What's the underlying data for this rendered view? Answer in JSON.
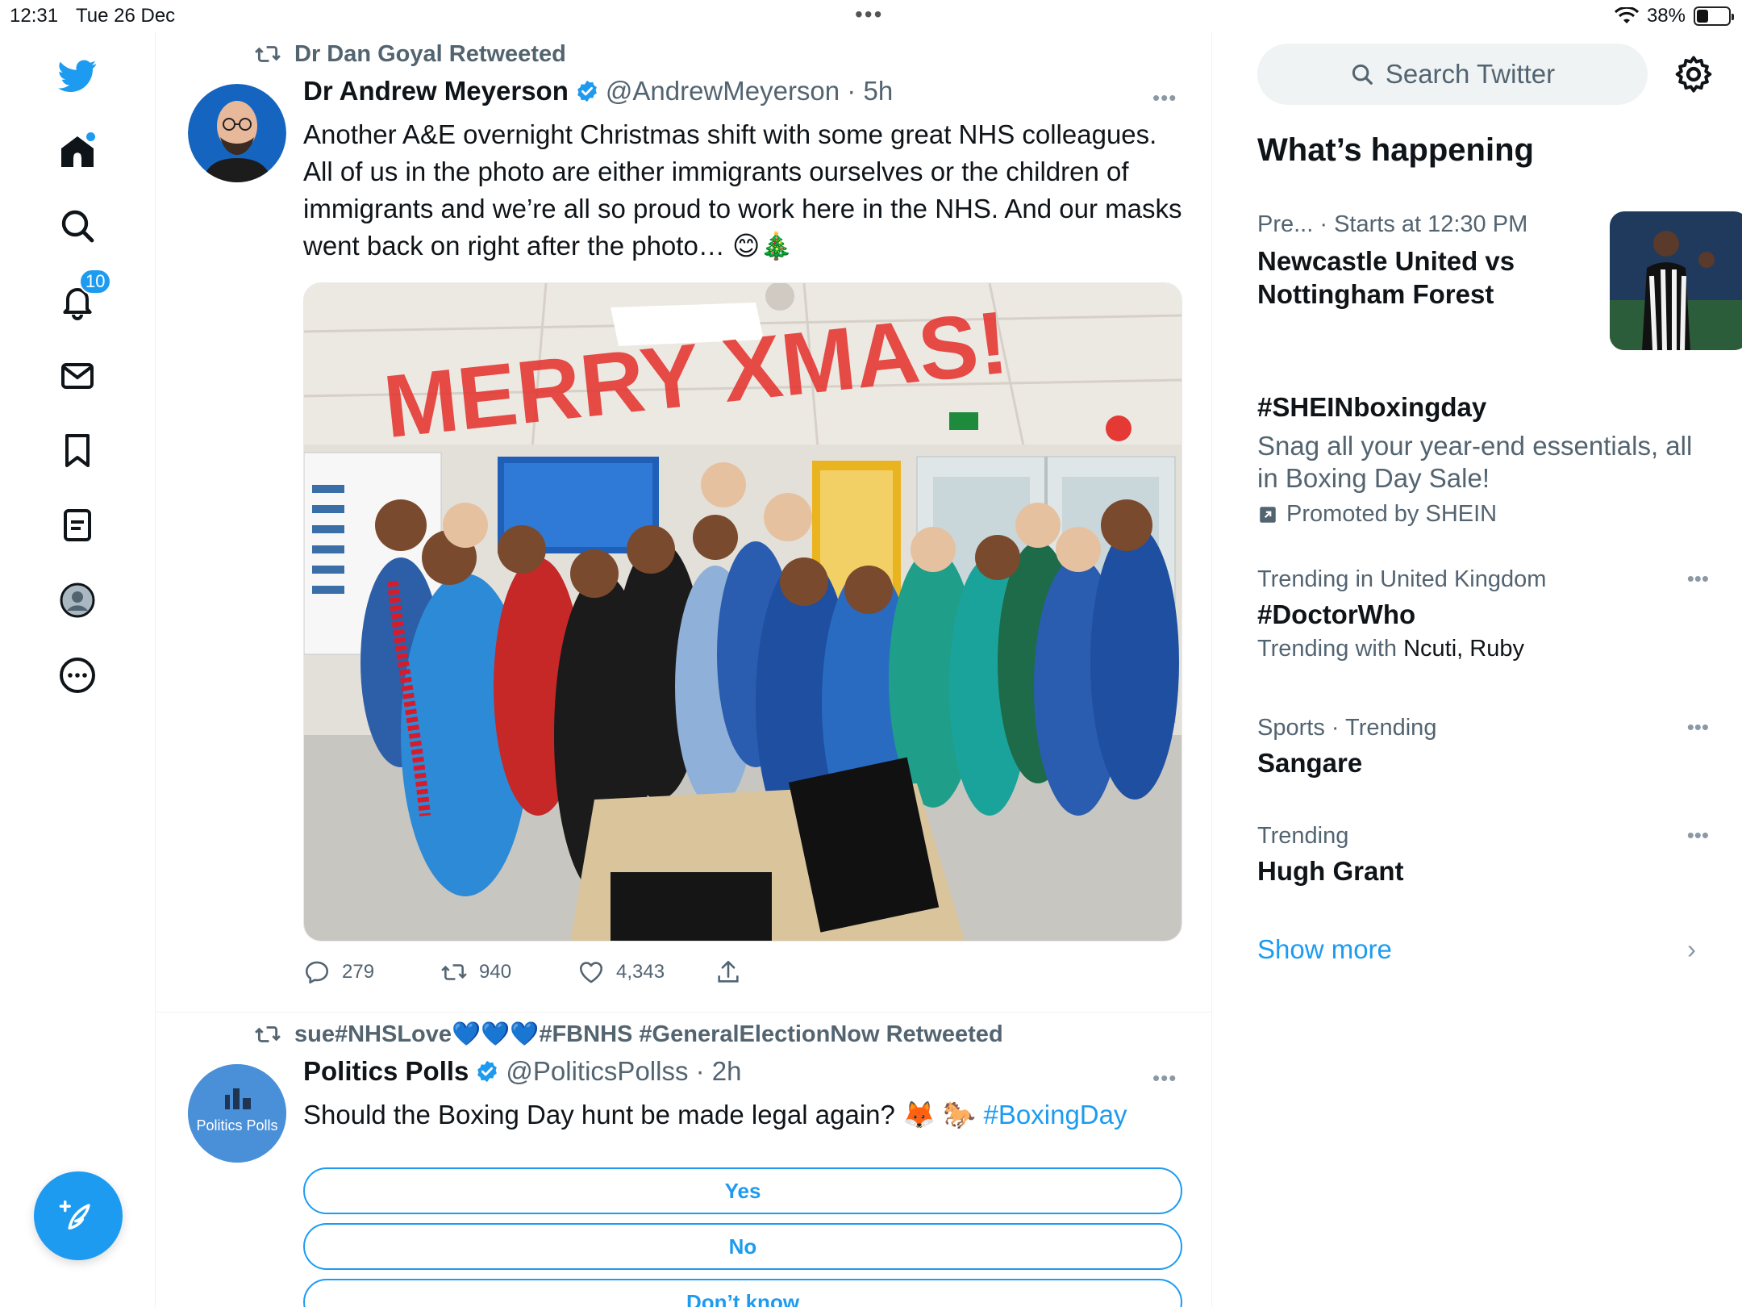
{
  "status_bar": {
    "time": "12:31",
    "date": "Tue 26 Dec",
    "battery_text": "38%",
    "battery_level": 0.38
  },
  "nav": {
    "items": [
      "twitter-logo",
      "home",
      "explore",
      "notifications",
      "messages",
      "bookmarks",
      "lists",
      "profile",
      "more"
    ],
    "notifications_badge": "10",
    "accent_color": "#1d9bf0"
  },
  "tweets": [
    {
      "retweeted_by": "Dr Dan Goyal Retweeted",
      "author_name": "Dr Andrew Meyerson",
      "handle_time": "@AndrewMeyerson · 5h",
      "text": "Another A&E overnight Christmas shift with some great NHS colleagues. All of us in the photo are either immigrants ourselves or the children of immigrants and we’re all so proud to work here in the NHS. And our masks went back on right after the photo… 😊🎄",
      "media_text": "MERRY XMAS!",
      "replies": "279",
      "retweets": "940",
      "likes": "4,343"
    },
    {
      "retweeted_by": "sue#NHSLove💙💙💙#FBNHS #GeneralElectionNow Retweeted",
      "author_name": "Politics Polls",
      "handle_time": "@PoliticsPollss · 2h",
      "avatar_text": "Politics Polls",
      "text": "Should the Boxing Day hunt be made legal again? 🦊 🐎 ",
      "hashtag": "#BoxingDay",
      "poll_options": [
        "Yes",
        "No",
        "Don’t know"
      ]
    }
  ],
  "sidebar": {
    "search_placeholder": "Search Twitter",
    "section_title": "What’s happening",
    "trends": [
      {
        "meta": "Pre... · Starts at 12:30 PM",
        "name": "Newcastle United vs Nottingham Forest"
      },
      {
        "name": "#SHEINboxingday",
        "desc": "Snag all your year-end essentials, all in Boxing Day Sale!",
        "promoted": "Promoted by SHEIN"
      },
      {
        "meta": "Trending in United Kingdom",
        "name": "#DoctorWho",
        "sub_prefix": "Trending with ",
        "sub_names": "Ncuti, Ruby"
      },
      {
        "meta": "Sports · Trending",
        "name": "Sangare"
      },
      {
        "meta": "Trending",
        "name": "Hugh Grant"
      }
    ],
    "show_more": "Show more"
  }
}
